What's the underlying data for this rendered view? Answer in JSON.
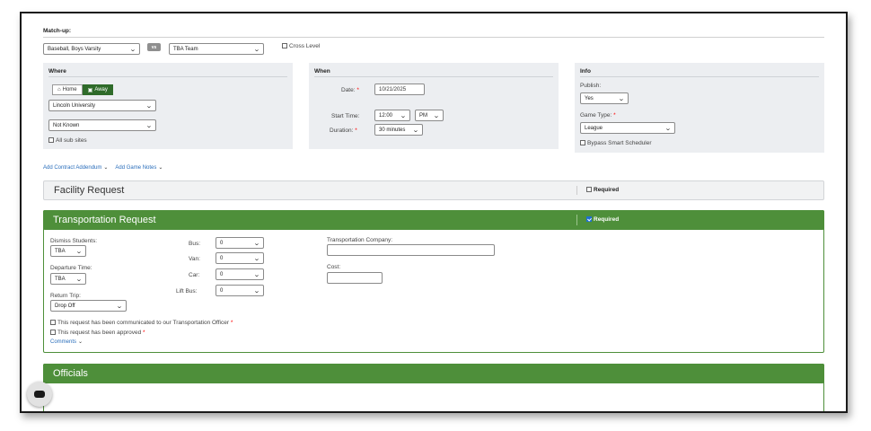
{
  "matchup": {
    "label": "Match-up:",
    "sport_value": "Baseball, Boys Varsity",
    "vs_badge": "vs",
    "opponent_value": "TBA Team",
    "cross_level_label": "Cross Level"
  },
  "where": {
    "title": "Where",
    "home_label": "Home",
    "away_label": "Away",
    "location_value": "Lincoln University",
    "site_value": "Not Known",
    "all_sub_sites_label": "All sub sites"
  },
  "when": {
    "title": "When",
    "date_label": "Date:",
    "date_value": "10/21/2025",
    "start_time_label": "Start Time:",
    "start_time_value": "12:00",
    "ampm_value": "PM",
    "duration_label": "Duration:",
    "duration_value": "30 minutes",
    "required_star": "*"
  },
  "info": {
    "title": "Info",
    "publish_label": "Publish:",
    "publish_value": "Yes",
    "game_type_label": "Game Type:",
    "game_type_value": "League",
    "bypass_label": "Bypass Smart Scheduler"
  },
  "links": {
    "contract_addendum": "Add Contract Addendum",
    "game_notes": "Add Game Notes"
  },
  "facility": {
    "title": "Facility Request",
    "required_label": "Required"
  },
  "transportation": {
    "title": "Transportation Request",
    "required_label": "Required",
    "dismiss_label": "Dismiss Students:",
    "dismiss_value": "TBA",
    "departure_label": "Departure Time:",
    "departure_value": "TBA",
    "return_label": "Return Trip:",
    "return_value": "Drop Off",
    "bus_label": "Bus:",
    "bus_value": "0",
    "van_label": "Van:",
    "van_value": "0",
    "car_label": "Car:",
    "car_value": "0",
    "lift_bus_label": "Lift Bus:",
    "lift_bus_value": "0",
    "company_label": "Transportation Company:",
    "company_value": "",
    "cost_label": "Cost:",
    "cost_value": "",
    "communicated_label": "This request has been communicated to our Transportation Officer",
    "approved_label": "This request has been approved",
    "comments_label": "Comments"
  },
  "officials": {
    "title": "Officials"
  },
  "colors": {
    "green": "#4e8f3a",
    "dark_green": "#2f6b2a",
    "panel_bg": "#eceef1"
  }
}
